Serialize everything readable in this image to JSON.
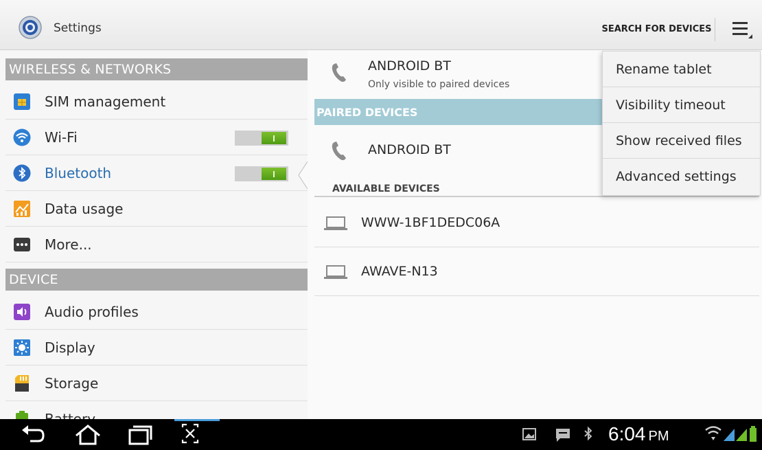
{
  "actionbar": {
    "title": "Settings",
    "icon": "settings-gear-icon",
    "search_label": "SEARCH FOR DEVICES",
    "overflow_icon": "overflow-menu-icon"
  },
  "sections": {
    "wireless": "WIRELESS & NETWORKS",
    "device": "DEVICE"
  },
  "settings_items": {
    "sim": "SIM management",
    "wifi": "Wi-Fi",
    "bluetooth": "Bluetooth",
    "data": "Data usage",
    "more": "More...",
    "audio": "Audio profiles",
    "display": "Display",
    "storage": "Storage",
    "battery": "Battery"
  },
  "toggles": {
    "wifi_on": true,
    "bluetooth_on": true
  },
  "bluetooth": {
    "this_device": {
      "name": "ANDROID BT",
      "status": "Only visible to paired devices"
    },
    "paired_header": "PAIRED DEVICES",
    "paired_device": "ANDROID BT",
    "available_header": "AVAILABLE DEVICES",
    "available": [
      "WWW-1BF1DEDC06A",
      "AWAVE-N13"
    ]
  },
  "menu": [
    "Rename tablet",
    "Visibility timeout",
    "Show received files",
    "Advanced settings"
  ],
  "statusbar": {
    "time": "6:04",
    "ampm": "PM"
  },
  "colors": {
    "accent_blue": "#2a6db0",
    "toggle_green": "#5aa81a",
    "paired_header": "#a2cbd6",
    "section_header": "#a9a9a9"
  }
}
